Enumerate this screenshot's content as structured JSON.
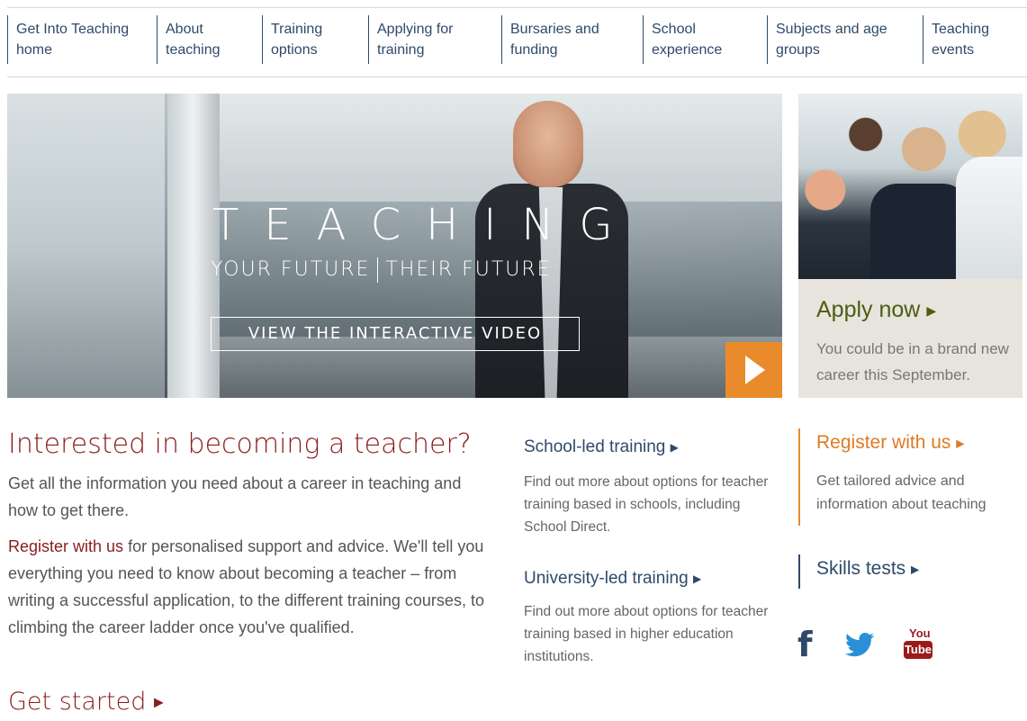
{
  "nav": {
    "items": [
      {
        "line1": "Get Into Teaching",
        "line2": "home"
      },
      {
        "line1": "About",
        "line2": "teaching"
      },
      {
        "line1": "Training",
        "line2": "options"
      },
      {
        "line1": "Applying for",
        "line2": "training"
      },
      {
        "line1": "Bursaries and",
        "line2": "funding"
      },
      {
        "line1": "School",
        "line2": "experience"
      },
      {
        "line1": "Subjects and age",
        "line2": "groups"
      },
      {
        "line1": "Teaching",
        "line2": "events"
      }
    ]
  },
  "hero": {
    "title": "TEACHING",
    "subtitle_left": "YOUR FUTURE",
    "subtitle_right": "THEIR FUTURE",
    "video_button": "VIEW THE INTERACTIVE VIDEO"
  },
  "apply": {
    "title": "Apply now",
    "arrow": "▶",
    "description": "You could be in a brand new career this September."
  },
  "intro": {
    "heading": "Interested in becoming a teacher?",
    "lead": "Get all the information you need about a career in teaching and how to get there.",
    "register_link": "Register with us",
    "body": " for personalised support and advice. We'll tell you everything you need to know about becoming a teacher – from writing a successful application, to the different training courses, to climbing the career ladder once you've qualified.",
    "get_started": "Get started",
    "arrow": "▶"
  },
  "training": {
    "school_title": "School-led training",
    "school_desc": "Find out more about options for teacher training based in schools, including School Direct.",
    "university_title": "University-led training",
    "university_desc": "Find out more about options for teacher training based in higher education institutions.",
    "arrow": "▶"
  },
  "register": {
    "title": "Register with us",
    "description": "Get tailored advice and information about teaching",
    "arrow": "▶"
  },
  "skills": {
    "title": "Skills tests",
    "arrow": "▶"
  },
  "social": {
    "facebook_glyph": "f",
    "youtube_top": "You",
    "youtube_bottom": "Tube"
  },
  "colors": {
    "nav_blue": "#2e4a6a",
    "maroon": "#8a1d1d",
    "orange": "#e98a2b",
    "olive": "#4c5d12"
  }
}
